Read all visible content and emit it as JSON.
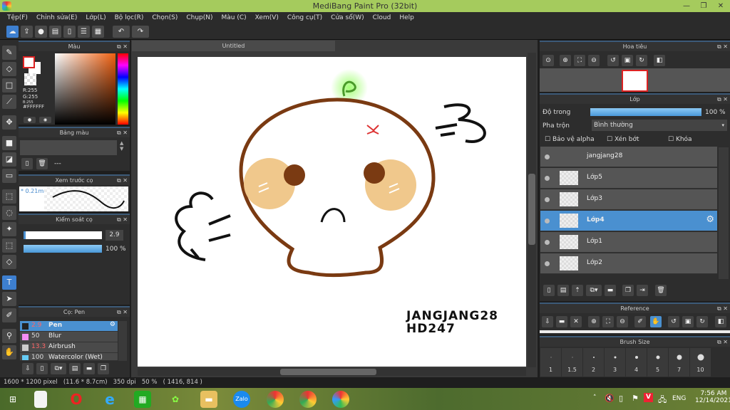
{
  "app": {
    "title": "MediBang Paint Pro (32bit)",
    "colors": {
      "titlebar": "#a5cb5d",
      "accent": "#4a90d0",
      "panel": "#2d2d2d"
    }
  },
  "menu": [
    "Tệp(F)",
    "Chỉnh sửa(E)",
    "Lớp(L)",
    "Bộ lọc(R)",
    "Chọn(S)",
    "Chụp(N)",
    "Màu (C)",
    "Xem(V)",
    "Công cụ(T)",
    "Cửa sổ(W)",
    "Cloud",
    "Help"
  ],
  "toolbar_icons": [
    "cloud-icon",
    "share-icon",
    "comment-icon",
    "message-icon",
    "page-icon",
    "list-icon",
    "grid-icon",
    "undo-icon",
    "redo-icon"
  ],
  "color_panel": {
    "title": "Màu",
    "r": "R:255",
    "g": "G:255",
    "b": "B:255",
    "hex": "#FFFFFF",
    "primary": "#ffffff",
    "secondary": "#ffffff"
  },
  "palette_panel": {
    "title": "Bảng màu",
    "entry": "---"
  },
  "brush_preview": {
    "title": "Xem trước cọ",
    "size": "* 0.21mm"
  },
  "brush_control": {
    "title": "Kiểm soát cọ",
    "size": "2.9",
    "opacity": "100 %",
    "opacity_value": 100
  },
  "brush_list": {
    "title": "Cọ: Pen",
    "items": [
      {
        "size": "2.9",
        "name": "Pen",
        "color": "#222222",
        "selected": true
      },
      {
        "size": "50",
        "name": "Blur",
        "color": "#f58cf5"
      },
      {
        "size": "13.3",
        "name": "Airbrush",
        "color": "#cccccc"
      },
      {
        "size": "100",
        "name": "Watercolor (Wet)",
        "color": "#66ccf5"
      }
    ]
  },
  "document": {
    "tab": "Untitled",
    "signature_line1": "JANGJANG28",
    "signature_line2": "HD247"
  },
  "navigator": {
    "title": "Hoa tiêu"
  },
  "layers": {
    "title": "Lớp",
    "opacity_label": "Độ trong",
    "opacity": "100 %",
    "opacity_value": 100,
    "blend_label": "Pha trộn",
    "blend": "Bình thường",
    "protect_alpha": "Bảo vệ alpha",
    "clipping": "Xén bớt",
    "lock": "Khóa",
    "items": [
      {
        "name": "jangjang28"
      },
      {
        "name": "Lớp5"
      },
      {
        "name": "Lớp3"
      },
      {
        "name": "Lớp4",
        "selected": true
      },
      {
        "name": "Lớp1"
      },
      {
        "name": "Lớp2"
      }
    ]
  },
  "reference": {
    "title": "Reference"
  },
  "brush_size": {
    "title": "Brush Size",
    "sizes": [
      "1",
      "1.5",
      "2",
      "3",
      "4",
      "5",
      "7",
      "10"
    ]
  },
  "status": {
    "size": "1600 * 1200 pixel",
    "physical": "(11.6 * 8.7cm)",
    "dpi": "350 dpi",
    "zoom": "50 %",
    "coords": "( 1416, 814 )"
  },
  "taskbar": {
    "lang": "ENG",
    "time": "7:56 AM",
    "date": "12/14/2021",
    "apps": [
      "start-icon",
      "file-icon",
      "opera-icon",
      "ie-icon",
      "store-icon",
      "app-icon",
      "explorer-icon",
      "zalo-icon",
      "chrome-icon",
      "chrome-profile-icon",
      "medibang-icon"
    ],
    "zalo": "Zalo"
  }
}
